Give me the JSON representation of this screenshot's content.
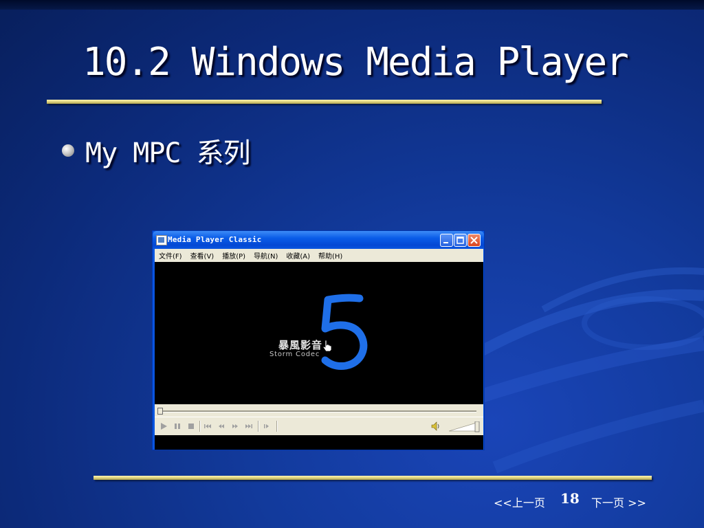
{
  "slide": {
    "title": "10.2 Windows Media Player",
    "bullet": "My MPC 系列"
  },
  "window": {
    "title": "Media Player Classic",
    "menu": [
      "文件(F)",
      "查看(V)",
      "播放(P)",
      "导航(N)",
      "收藏(A)",
      "帮助(H)"
    ],
    "logo_cn": "暴風影音",
    "logo_en": "Storm Codec",
    "controls": [
      "play",
      "pause",
      "stop",
      "skip-back",
      "rewind",
      "fast-forward",
      "skip-forward",
      "frame-step"
    ]
  },
  "nav": {
    "prev": "<<上一页",
    "page": "18",
    "next": "下一页 >>"
  },
  "colors": {
    "background": "#123a9c",
    "rule": "#d8cc76",
    "titlebar": "#0a5ce8",
    "logo_blue": "#1f6fe8"
  }
}
